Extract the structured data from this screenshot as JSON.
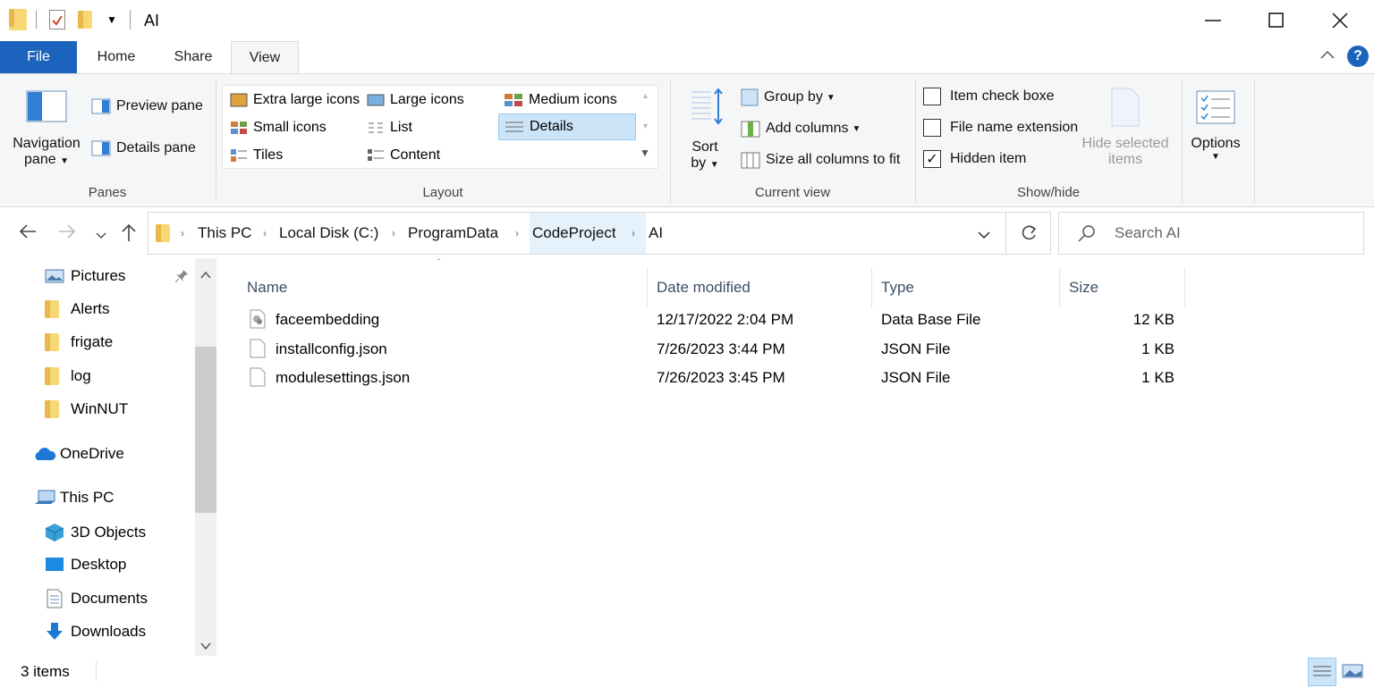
{
  "window": {
    "title": "AI"
  },
  "tabs": {
    "file": "File",
    "home": "Home",
    "share": "Share",
    "view": "View"
  },
  "panes": {
    "navigation_pane": "Navigation",
    "navigation_pane_2": "pane",
    "preview_pane": "Preview pane",
    "details_pane": "Details pane",
    "group_label": "Panes"
  },
  "layout": {
    "extra_large": "Extra large icons",
    "large": "Large icons",
    "medium": "Medium icons",
    "small": "Small icons",
    "list": "List",
    "details": "Details",
    "tiles": "Tiles",
    "content": "Content",
    "group_label": "Layout"
  },
  "current_view": {
    "sort_by": "Sort",
    "sort_by_2": "by",
    "group_by": "Group by",
    "add_columns": "Add columns",
    "size_columns": "Size all columns to fit",
    "group_label": "Current view"
  },
  "show_hide": {
    "item_checkboxes": "Item check boxe",
    "file_name_ext": "File name extension",
    "hidden_items": "Hidden item",
    "hide_selected": "Hide selected",
    "hide_selected_2": "items",
    "group_label": "Show/hide"
  },
  "options": {
    "label": "Options"
  },
  "address": {
    "crumbs": [
      "This PC",
      "Local Disk (C:)",
      "ProgramData",
      "CodeProject",
      "AI"
    ]
  },
  "search": {
    "placeholder": "Search AI"
  },
  "nav": {
    "items": [
      "Pictures",
      "Alerts",
      "frigate",
      "log",
      "WinNUT",
      "OneDrive",
      "This PC",
      "3D Objects",
      "Desktop",
      "Documents",
      "Downloads"
    ]
  },
  "columns": {
    "name": "Name",
    "date": "Date modified",
    "type": "Type",
    "size": "Size"
  },
  "files": [
    {
      "name": "faceembedding",
      "date": "12/17/2022 2:04 PM",
      "type": "Data Base File",
      "size": "12 KB"
    },
    {
      "name": "installconfig.json",
      "date": "7/26/2023 3:44 PM",
      "type": "JSON File",
      "size": "1 KB"
    },
    {
      "name": "modulesettings.json",
      "date": "7/26/2023 3:45 PM",
      "type": "JSON File",
      "size": "1 KB"
    }
  ],
  "status": {
    "count": "3 items"
  },
  "colors": {
    "accent": "#1c63bd",
    "selection": "#cce4f7",
    "header_text": "#3c4e6a"
  }
}
